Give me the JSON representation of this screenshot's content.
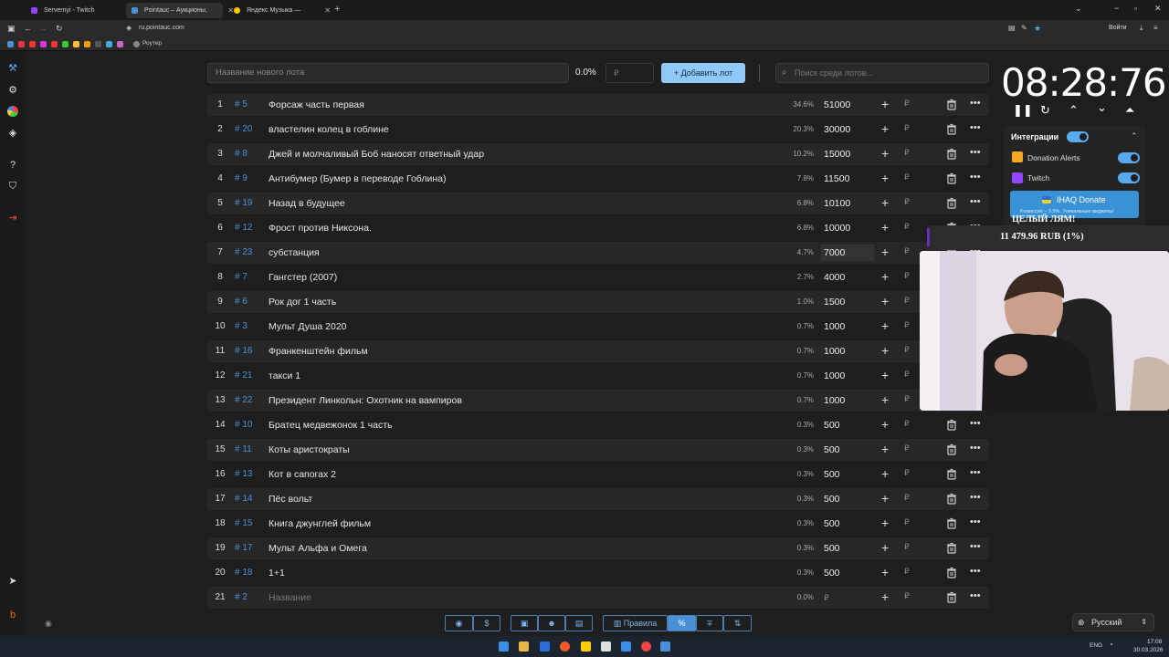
{
  "browser": {
    "tabs": [
      {
        "label": "Servernyi - Twitch",
        "color": "#9146ff"
      },
      {
        "label": "Pointauc – Аукционы, лотере",
        "color": "#4a90d9"
      },
      {
        "label": "Яндекс Музыка — собира",
        "color": "#ffcc00"
      }
    ],
    "url": "ru.pointauc.com",
    "bookmark_label": "Роутер",
    "login_label": "Войти"
  },
  "toolbar": {
    "new_lot_placeholder": "Название нового лота",
    "percent": "0.0%",
    "rub_placeholder": "₽",
    "add_button": "Добавить лот",
    "search_placeholder": "Поиск среди лотов..."
  },
  "lots": [
    {
      "n": "1",
      "id": "# 5",
      "name": "Форсаж часть первая",
      "pct": "34.6%",
      "amount": "51000"
    },
    {
      "n": "2",
      "id": "# 20",
      "name": "властелин колец в гоблине",
      "pct": "20.3%",
      "amount": "30000"
    },
    {
      "n": "3",
      "id": "# 8",
      "name": "Джей и молчаливый Боб наносят ответный удар",
      "pct": "10.2%",
      "amount": "15000"
    },
    {
      "n": "4",
      "id": "# 9",
      "name": "Антибумер (Бумер в переводе Гоблина)",
      "pct": "7.8%",
      "amount": "11500"
    },
    {
      "n": "5",
      "id": "# 19",
      "name": "Назад в будущее",
      "pct": "6.8%",
      "amount": "10100"
    },
    {
      "n": "6",
      "id": "# 12",
      "name": "Фрост против Никсона.",
      "pct": "6.8%",
      "amount": "10000"
    },
    {
      "n": "7",
      "id": "# 23",
      "name": "субстанция",
      "pct": "4.7%",
      "amount": "7000"
    },
    {
      "n": "8",
      "id": "# 7",
      "name": "Гангстер (2007)",
      "pct": "2.7%",
      "amount": "4000"
    },
    {
      "n": "9",
      "id": "# 6",
      "name": "Рок дог 1 часть",
      "pct": "1.0%",
      "amount": "1500"
    },
    {
      "n": "10",
      "id": "# 3",
      "name": "Мульт Душа 2020",
      "pct": "0.7%",
      "amount": "1000"
    },
    {
      "n": "11",
      "id": "# 16",
      "name": "Франкенштейн  фильм",
      "pct": "0.7%",
      "amount": "1000"
    },
    {
      "n": "12",
      "id": "# 21",
      "name": "такси 1",
      "pct": "0.7%",
      "amount": "1000"
    },
    {
      "n": "13",
      "id": "# 22",
      "name": "Президент Линкольн: Охотник на вампиров",
      "pct": "0.7%",
      "amount": "1000"
    },
    {
      "n": "14",
      "id": "# 10",
      "name": "Братец медвежонок 1 часть",
      "pct": "0.3%",
      "amount": "500"
    },
    {
      "n": "15",
      "id": "# 11",
      "name": "Коты аристократы",
      "pct": "0.3%",
      "amount": "500"
    },
    {
      "n": "16",
      "id": "# 13",
      "name": "Кот в сапогах 2",
      "pct": "0.3%",
      "amount": "500"
    },
    {
      "n": "17",
      "id": "# 14",
      "name": "Пёс вольт",
      "pct": "0.3%",
      "amount": "500"
    },
    {
      "n": "18",
      "id": "# 15",
      "name": "Книга джунглей фильм",
      "pct": "0.3%",
      "amount": "500"
    },
    {
      "n": "19",
      "id": "# 17",
      "name": "Мульт Альфа и Омега",
      "pct": "0.3%",
      "amount": "500"
    },
    {
      "n": "20",
      "id": "# 18",
      "name": "1+1",
      "pct": "0.3%",
      "amount": "500"
    },
    {
      "n": "21",
      "id": "# 2",
      "name": "Название",
      "pct": "0.0%",
      "amount": "₽",
      "placeholder": true
    }
  ],
  "currency_sign": "₽",
  "timer": "08:28:76",
  "integrations": {
    "title": "Интеграции",
    "items": [
      {
        "label": "Donation Alerts",
        "color": "#f5a623"
      },
      {
        "label": "Twitch",
        "color": "#9146ff"
      }
    ],
    "ihaq_title": "IHAQ Donate",
    "ihaq_sub": "Комиссия – 3.5%. Уникальные виджеты!"
  },
  "overlay": {
    "goal_text": "ЦЕЛЫЙ ЛЯМ!",
    "donation_text": "11 479.96 RUB (1%)"
  },
  "bottom_bar": {
    "rules_label": "Правила",
    "language": "Русский"
  },
  "taskbar": {
    "lang": "ENG",
    "time": "17:08",
    "date": "30.03.2026"
  }
}
